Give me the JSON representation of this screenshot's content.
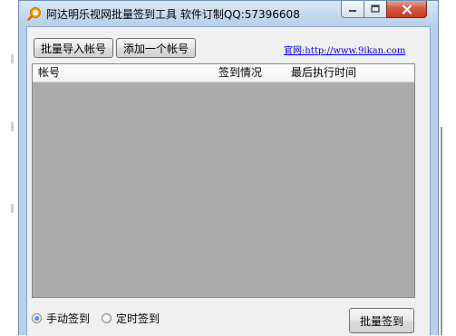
{
  "window": {
    "title": "阿达明乐视网批量签到工具 软件订制QQ:57396608",
    "controls": [
      "minimize",
      "maximize",
      "close"
    ]
  },
  "toolbar": {
    "import_label": "批量导入帐号",
    "add_label": "添加一个帐号",
    "site_link": "官网:http://www.9ikan.com"
  },
  "accounts_table": {
    "columns": [
      "帐号",
      "签到情况",
      "最后执行时间"
    ],
    "rows": []
  },
  "mode": {
    "options": [
      {
        "label": "手动签到",
        "selected": true
      },
      {
        "label": "定时签到",
        "selected": false
      }
    ]
  },
  "actions": {
    "sign_label": "批量签到"
  },
  "colors": {
    "title_bar": "#c4d9ef",
    "close_button": "#c43a21",
    "list_background": "#ababab",
    "link": "#0000ee"
  },
  "icons": [
    "app-search-icon",
    "minimize-icon",
    "maximize-icon",
    "close-icon"
  ]
}
